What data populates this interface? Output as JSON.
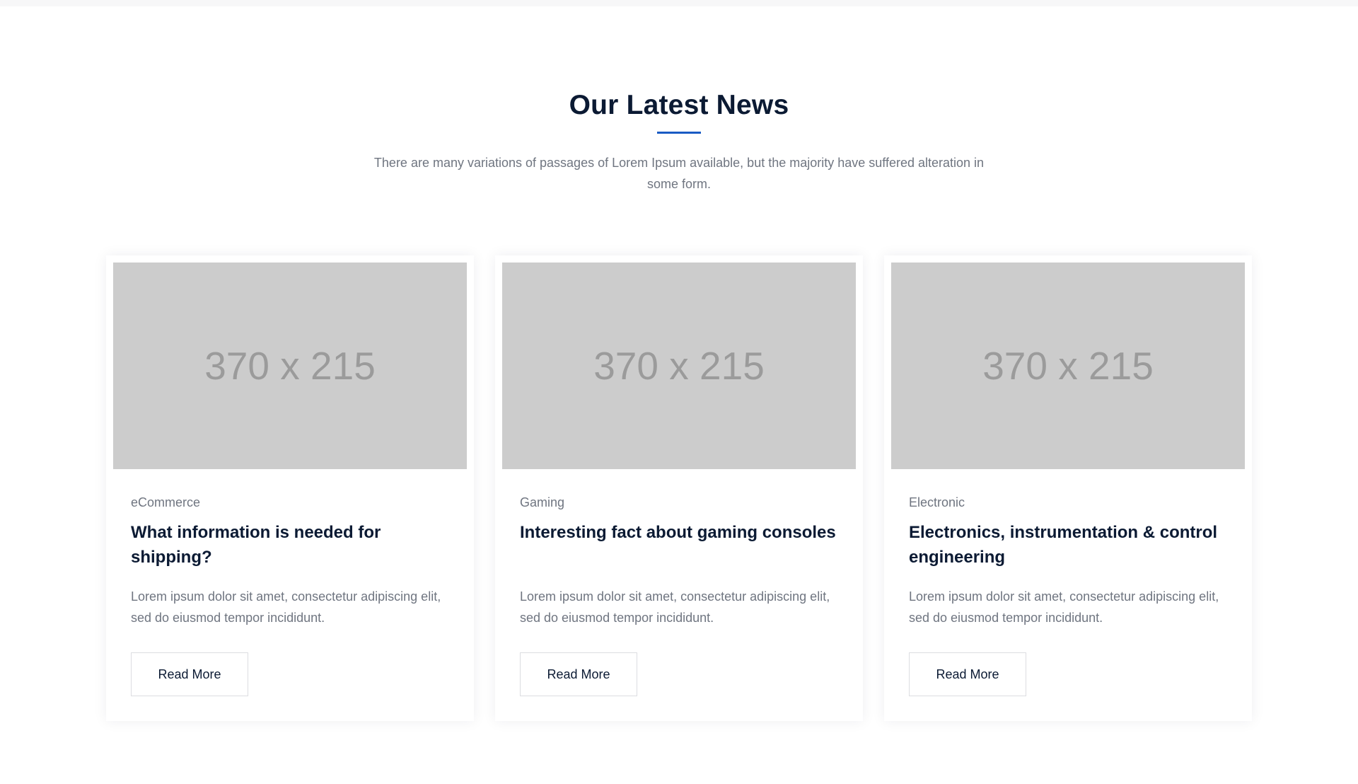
{
  "section": {
    "title": "Our Latest News",
    "description": "There are many variations of passages of Lorem Ipsum available, but the majority have suffered alteration in some form."
  },
  "cards": [
    {
      "image_label": "370 x 215",
      "category": "eCommerce",
      "title": "What information is needed for shipping?",
      "text": "Lorem ipsum dolor sit amet, consectetur adipiscing elit, sed do eiusmod tempor incididunt.",
      "button_label": "Read More"
    },
    {
      "image_label": "370 x 215",
      "category": "Gaming",
      "title": "Interesting fact about gaming consoles",
      "text": "Lorem ipsum dolor sit amet, consectetur adipiscing elit, sed do eiusmod tempor incididunt.",
      "button_label": "Read More"
    },
    {
      "image_label": "370 x 215",
      "category": "Electronic",
      "title": "Electronics, instrumentation & control engineering",
      "text": "Lorem ipsum dolor sit amet, consectetur adipiscing elit, sed do eiusmod tempor incididunt.",
      "button_label": "Read More"
    }
  ],
  "colors": {
    "heading": "#0b1a33",
    "accent": "#1a5bc4",
    "body_text": "#6f7580",
    "placeholder_bg": "#cccccc",
    "placeholder_text": "#9b9b9b"
  }
}
